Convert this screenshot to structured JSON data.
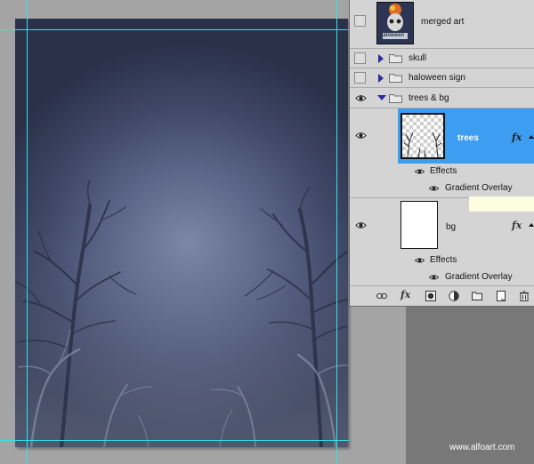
{
  "layers": {
    "merged": {
      "name": "merged art",
      "thumb_text": "Haloween"
    },
    "skull": {
      "name": "skull"
    },
    "sign": {
      "name": "haloween sign"
    },
    "group": {
      "name": "trees & bg"
    },
    "trees": {
      "name": "trees",
      "fx": "fx"
    },
    "trees_effects": {
      "label": "Effects",
      "item": "Gradient Overlay"
    },
    "bg": {
      "name": "bg",
      "fx": "fx"
    },
    "bg_effects": {
      "label": "Effects",
      "item": "Gradient Overlay"
    }
  },
  "icons": {
    "panel_bottom": [
      "link-icon",
      "fx-icon",
      "mask-icon",
      "adjustment-icon",
      "folder-icon",
      "new-layer-icon",
      "trash-icon"
    ]
  },
  "panel_bottom_fx": "fx",
  "watermark": "www.alfoart.com",
  "colors": {
    "selection": "#3d9df0",
    "guide": "#33e1e8",
    "canvas_center": "#7b86a7",
    "canvas_edge": "#2b3149"
  }
}
